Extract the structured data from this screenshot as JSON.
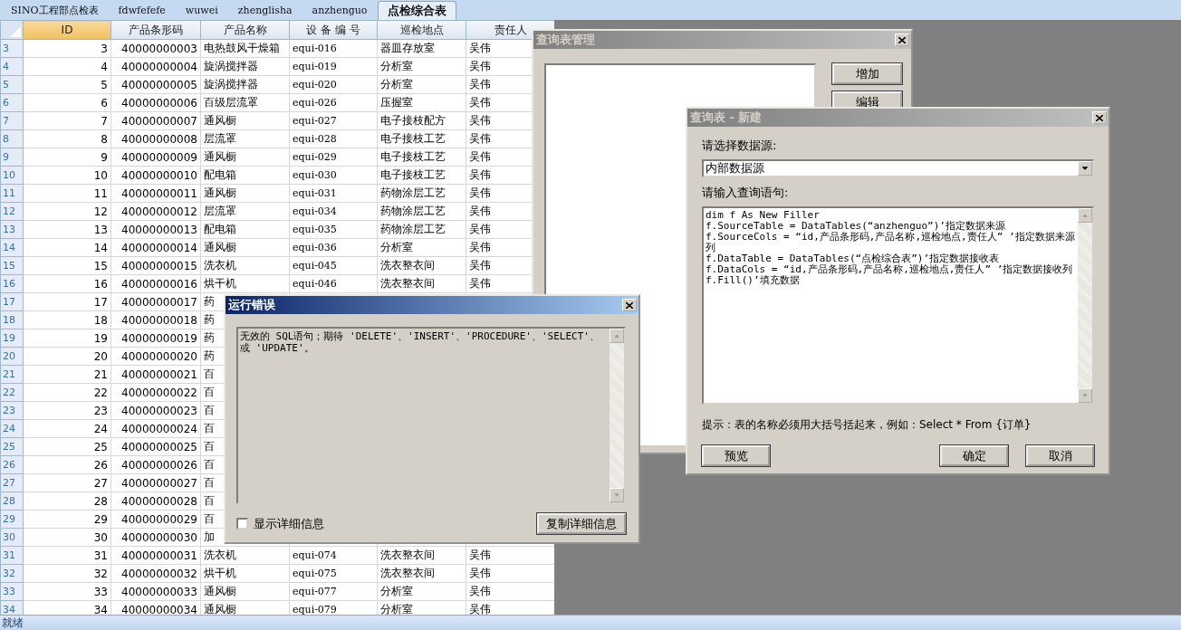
{
  "tabs": [
    {
      "label": "SINO工程部点检表",
      "selected": false
    },
    {
      "label": "fdwfefefe",
      "selected": false
    },
    {
      "label": "wuwei",
      "selected": false
    },
    {
      "label": "zhenglisha",
      "selected": false
    },
    {
      "label": "anzhenguo",
      "selected": false
    },
    {
      "label": "点检综合表",
      "selected": true
    }
  ],
  "grid": {
    "columns": [
      {
        "label": "ID",
        "selected": true
      },
      {
        "label": "产品条形码",
        "selected": false
      },
      {
        "label": "产品名称",
        "selected": false
      },
      {
        "label": "设 备 编 号",
        "selected": false
      },
      {
        "label": "巡检地点",
        "selected": false
      },
      {
        "label": "责任人",
        "selected": false
      }
    ],
    "rows": [
      {
        "row": "3",
        "cells": [
          "3",
          "40000000003",
          "电热鼓风干燥箱",
          "equi-016",
          "器皿存放室",
          "吴伟"
        ]
      },
      {
        "row": "4",
        "cells": [
          "4",
          "40000000004",
          "旋涡搅拌器",
          "equi-019",
          "分析室",
          "吴伟"
        ]
      },
      {
        "row": "5",
        "cells": [
          "5",
          "40000000005",
          "旋涡搅拌器",
          "equi-020",
          "分析室",
          "吴伟"
        ]
      },
      {
        "row": "6",
        "cells": [
          "6",
          "40000000006",
          "百级层流罩",
          "equi-026",
          "压握室",
          "吴伟"
        ]
      },
      {
        "row": "7",
        "cells": [
          "7",
          "40000000007",
          "通风橱",
          "equi-027",
          "电子接枝配方",
          "吴伟"
        ]
      },
      {
        "row": "8",
        "cells": [
          "8",
          "40000000008",
          "层流罩",
          "equi-028",
          "电子接枝工艺",
          "吴伟"
        ]
      },
      {
        "row": "9",
        "cells": [
          "9",
          "40000000009",
          "通风橱",
          "equi-029",
          "电子接枝工艺",
          "吴伟"
        ]
      },
      {
        "row": "10",
        "cells": [
          "10",
          "40000000010",
          "配电箱",
          "equi-030",
          "电子接枝工艺",
          "吴伟"
        ]
      },
      {
        "row": "11",
        "cells": [
          "11",
          "40000000011",
          "通风橱",
          "equi-031",
          "药物涂层工艺",
          "吴伟"
        ]
      },
      {
        "row": "12",
        "cells": [
          "12",
          "40000000012",
          "层流罩",
          "equi-034",
          "药物涂层工艺",
          "吴伟"
        ]
      },
      {
        "row": "13",
        "cells": [
          "13",
          "40000000013",
          "配电箱",
          "equi-035",
          "药物涂层工艺",
          "吴伟"
        ]
      },
      {
        "row": "14",
        "cells": [
          "14",
          "40000000014",
          "通风橱",
          "equi-036",
          "分析室",
          "吴伟"
        ]
      },
      {
        "row": "15",
        "cells": [
          "15",
          "40000000015",
          "洗衣机",
          "equi-045",
          "洗衣整衣间",
          "吴伟"
        ]
      },
      {
        "row": "16",
        "cells": [
          "16",
          "40000000016",
          "烘干机",
          "equi-046",
          "洗衣整衣间",
          "吴伟"
        ]
      },
      {
        "row": "17",
        "cells": [
          "17",
          "40000000017",
          "药"
        ]
      },
      {
        "row": "18",
        "cells": [
          "18",
          "40000000018",
          "药"
        ]
      },
      {
        "row": "19",
        "cells": [
          "19",
          "40000000019",
          "药"
        ]
      },
      {
        "row": "20",
        "cells": [
          "20",
          "40000000020",
          "药"
        ]
      },
      {
        "row": "21",
        "cells": [
          "21",
          "40000000021",
          "百"
        ]
      },
      {
        "row": "22",
        "cells": [
          "22",
          "40000000022",
          "百"
        ]
      },
      {
        "row": "23",
        "cells": [
          "23",
          "40000000023",
          "百"
        ]
      },
      {
        "row": "24",
        "cells": [
          "24",
          "40000000024",
          "百"
        ]
      },
      {
        "row": "25",
        "cells": [
          "25",
          "40000000025",
          "百"
        ]
      },
      {
        "row": "26",
        "cells": [
          "26",
          "40000000026",
          "百"
        ]
      },
      {
        "row": "27",
        "cells": [
          "27",
          "40000000027",
          "百"
        ]
      },
      {
        "row": "28",
        "cells": [
          "28",
          "40000000028",
          "百"
        ]
      },
      {
        "row": "29",
        "cells": [
          "29",
          "40000000029",
          "百"
        ]
      },
      {
        "row": "30",
        "cells": [
          "30",
          "40000000030",
          "加"
        ]
      },
      {
        "row": "31",
        "cells": [
          "31",
          "40000000031",
          "洗衣机",
          "equi-074",
          "洗衣整衣间",
          "吴伟"
        ]
      },
      {
        "row": "32",
        "cells": [
          "32",
          "40000000032",
          "烘干机",
          "equi-075",
          "洗衣整衣间",
          "吴伟"
        ]
      },
      {
        "row": "33",
        "cells": [
          "33",
          "40000000033",
          "通风橱",
          "equi-077",
          "分析室",
          "吴伟"
        ]
      },
      {
        "row": "34",
        "cells": [
          "34",
          "40000000034",
          "通风橱",
          "equi-079",
          "分析室",
          "吴伟"
        ]
      }
    ]
  },
  "query_manager": {
    "title": "查询表管理",
    "buttons": [
      "增加",
      "编辑"
    ]
  },
  "query_new": {
    "title": "查询表 - 新建",
    "source_label": "请选择数据源:",
    "source_value": "内部数据源",
    "query_label": "请输入查询语句:",
    "query": "dim f As New Filler\nf.SourceTable = DataTables(“anzhenguo”)’指定数据来源\nf.SourceCols = “id,产品条形码,产品名称,巡检地点,责任人” ’指定数据来源列\nf.DataTable = DataTables(“点检综合表”)’指定数据接收表\nf.DataCols = “id,产品条形码,产品名称,巡检地点,责任人” ’指定数据接收列\nf.Fill()’填充数据",
    "hint": "提示：表的名称必须用大括号括起来，例如：Select * From {订单}",
    "left_buttons": [
      "预览"
    ],
    "right_buttons": [
      "确定",
      "取消"
    ]
  },
  "error_dialog": {
    "title": "运行错误",
    "message": "无效的 SQL语句；期待 'DELETE'、'INSERT'、'PROCEDURE'、'SELECT'、或 'UPDATE'。",
    "show_details": {
      "label": "显示详细信息",
      "checked": false
    },
    "copy_button": "复制详细信息"
  },
  "status_bar": "就绪"
}
